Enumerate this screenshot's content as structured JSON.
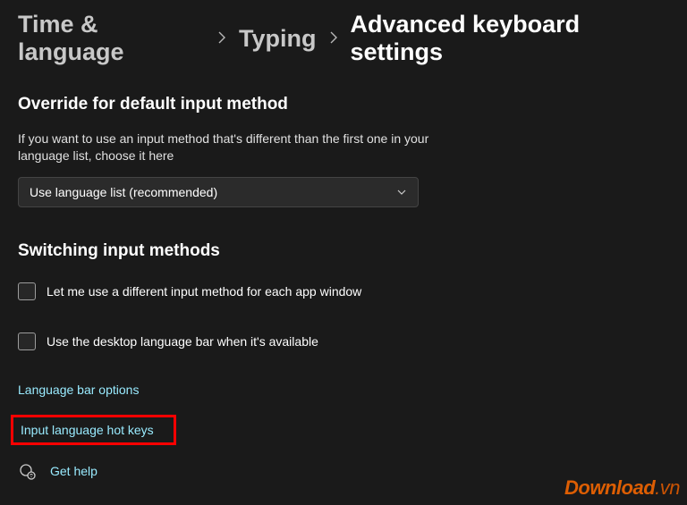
{
  "breadcrumb": {
    "root": "Time & language",
    "mid": "Typing",
    "current": "Advanced keyboard settings"
  },
  "override": {
    "title": "Override for default input method",
    "subtitle": "If you want to use an input method that's different than the first one in your language list, choose it here",
    "dropdown_value": "Use language list (recommended)"
  },
  "switching": {
    "title": "Switching input methods",
    "cb_per_app": "Let me use a different input method for each app window",
    "cb_deskbar": "Use the desktop language bar when it's available"
  },
  "links": {
    "lang_bar": "Language bar options",
    "hotkeys": "Input language hot keys"
  },
  "help": {
    "label": "Get help"
  },
  "watermark": {
    "brand": "Download",
    "tld": ".vn"
  }
}
